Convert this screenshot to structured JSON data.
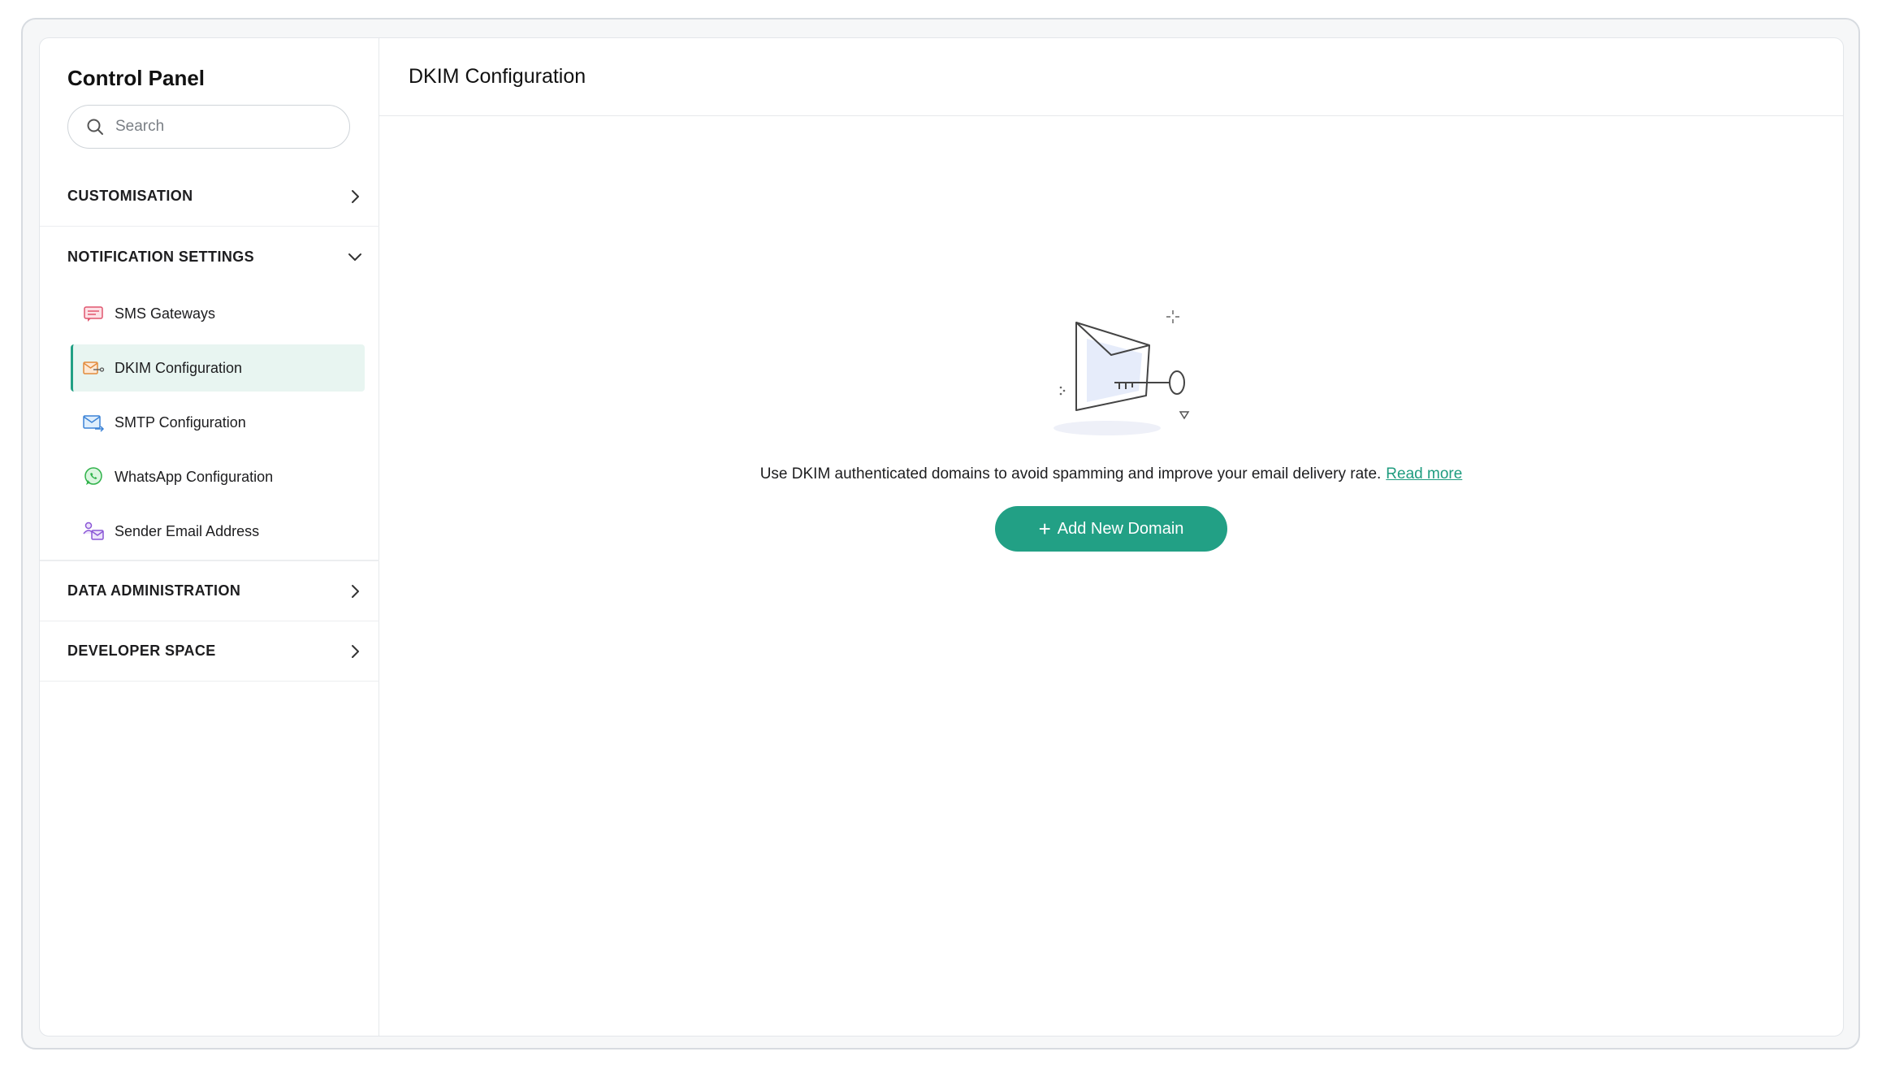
{
  "sidebar": {
    "title": "Control Panel",
    "search_placeholder": "Search",
    "sections": [
      {
        "label": "CUSTOMISATION",
        "icon": "chevron-right-icon"
      },
      {
        "label": "NOTIFICATION SETTINGS",
        "icon": "chevron-down-icon"
      },
      {
        "label": "DATA ADMINISTRATION",
        "icon": "chevron-right-icon"
      },
      {
        "label": "DEVELOPER SPACE",
        "icon": "chevron-right-icon"
      }
    ],
    "notification_items": [
      {
        "label": "SMS Gateways",
        "icon": "sms-icon"
      },
      {
        "label": "DKIM Configuration",
        "icon": "dkim-icon",
        "active": true
      },
      {
        "label": "SMTP Configuration",
        "icon": "smtp-icon"
      },
      {
        "label": "WhatsApp Configuration",
        "icon": "whatsapp-icon"
      },
      {
        "label": "Sender Email Address",
        "icon": "sender-email-icon"
      }
    ]
  },
  "main": {
    "title": "DKIM Configuration",
    "empty_text": "Use DKIM authenticated domains to avoid spamming and improve your email delivery rate.",
    "read_more": "Read more",
    "add_button_label": "Add New Domain"
  },
  "colors": {
    "accent": "#22a085",
    "active_bg": "#e8f5f1",
    "border": "#e6e8eb"
  }
}
